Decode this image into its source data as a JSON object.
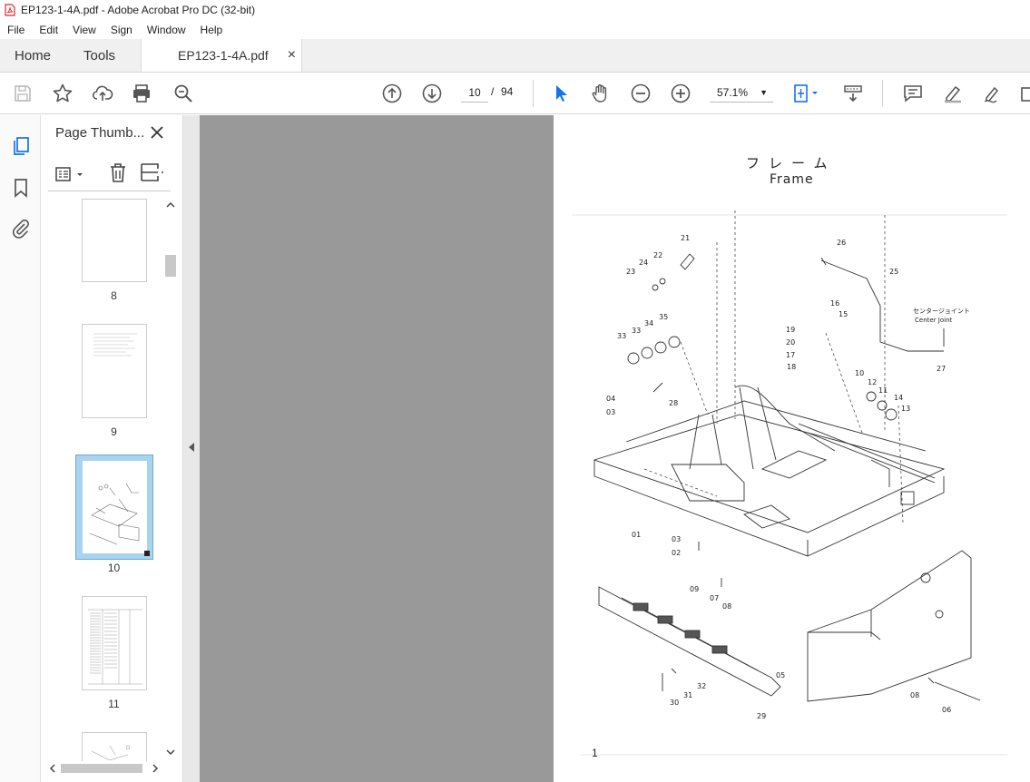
{
  "window": {
    "title": "EP123-1-4A.pdf - Adobe Acrobat Pro DC (32-bit)"
  },
  "menu": [
    "File",
    "Edit",
    "View",
    "Sign",
    "Window",
    "Help"
  ],
  "tabs": {
    "home": "Home",
    "tools": "Tools",
    "document": "EP123-1-4A.pdf",
    "close": "×"
  },
  "nav": {
    "current_page": "10",
    "separator": "/",
    "total_pages": "94",
    "zoom": "57.1%"
  },
  "panel": {
    "title": "Page Thumb...",
    "thumbnails": [
      {
        "label": "8"
      },
      {
        "label": "9"
      },
      {
        "label": "10"
      },
      {
        "label": "11"
      }
    ]
  },
  "document": {
    "title_jp": "フレーム",
    "title_en": "Frame",
    "page_number": "1",
    "center_joint_jp": "センタージョイント",
    "center_joint_en": "Center Joint",
    "part_numbers": [
      "01",
      "02",
      "03",
      "03",
      "04",
      "05",
      "06",
      "07",
      "08",
      "08",
      "09",
      "10",
      "11",
      "12",
      "13",
      "14",
      "15",
      "16",
      "17",
      "18",
      "19",
      "20",
      "21",
      "22",
      "23",
      "24",
      "25",
      "26",
      "27",
      "28",
      "29",
      "30",
      "31",
      "32",
      "33",
      "33",
      "34",
      "35"
    ]
  },
  "colors": {
    "accent": "#1473e6",
    "pdf_red": "#d9282f",
    "doc_bg": "#999999",
    "thumb_selected": "#a8d4f0"
  }
}
